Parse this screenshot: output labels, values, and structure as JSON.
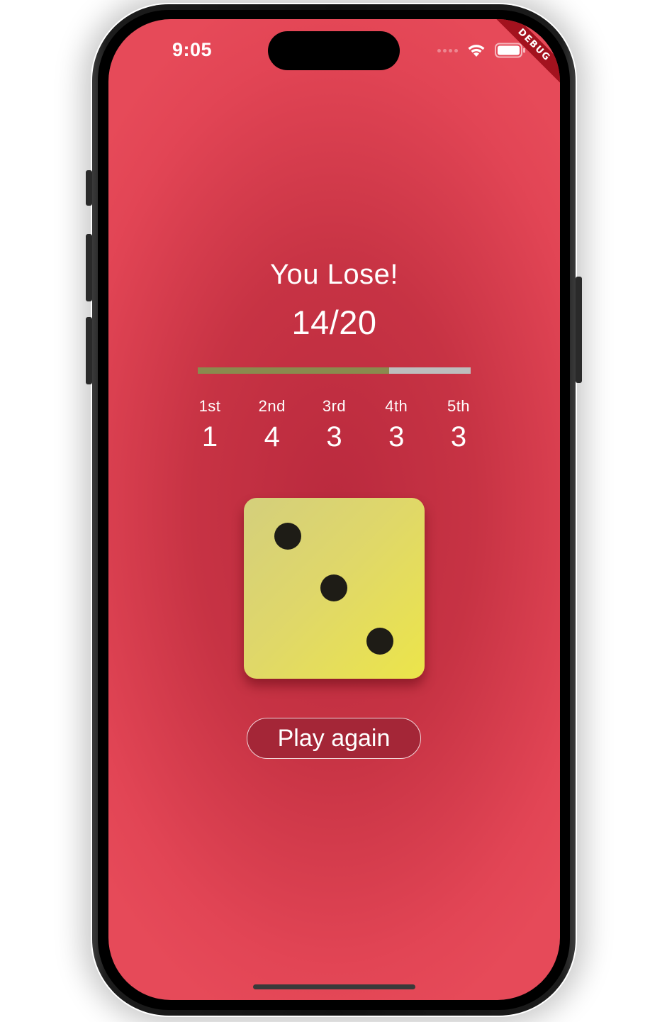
{
  "status_bar": {
    "time": "9:05",
    "wifi_icon": "wifi-icon",
    "battery_icon": "battery-icon"
  },
  "debug_banner": "DEBUG",
  "result": {
    "title": "You Lose!",
    "score_text": "14/20",
    "progress_fraction": 0.7
  },
  "rolls": [
    {
      "label": "1st",
      "value": "1"
    },
    {
      "label": "2nd",
      "value": "4"
    },
    {
      "label": "3rd",
      "value": "3"
    },
    {
      "label": "4th",
      "value": "3"
    },
    {
      "label": "5th",
      "value": "3"
    }
  ],
  "die": {
    "face_value": 3
  },
  "actions": {
    "play_again_label": "Play again"
  },
  "colors": {
    "background": "#c73344",
    "progress_fill": "#8a8a4e",
    "progress_track": "#bdbdbd",
    "die_face": "#dfd76a",
    "button": "#a42637"
  }
}
